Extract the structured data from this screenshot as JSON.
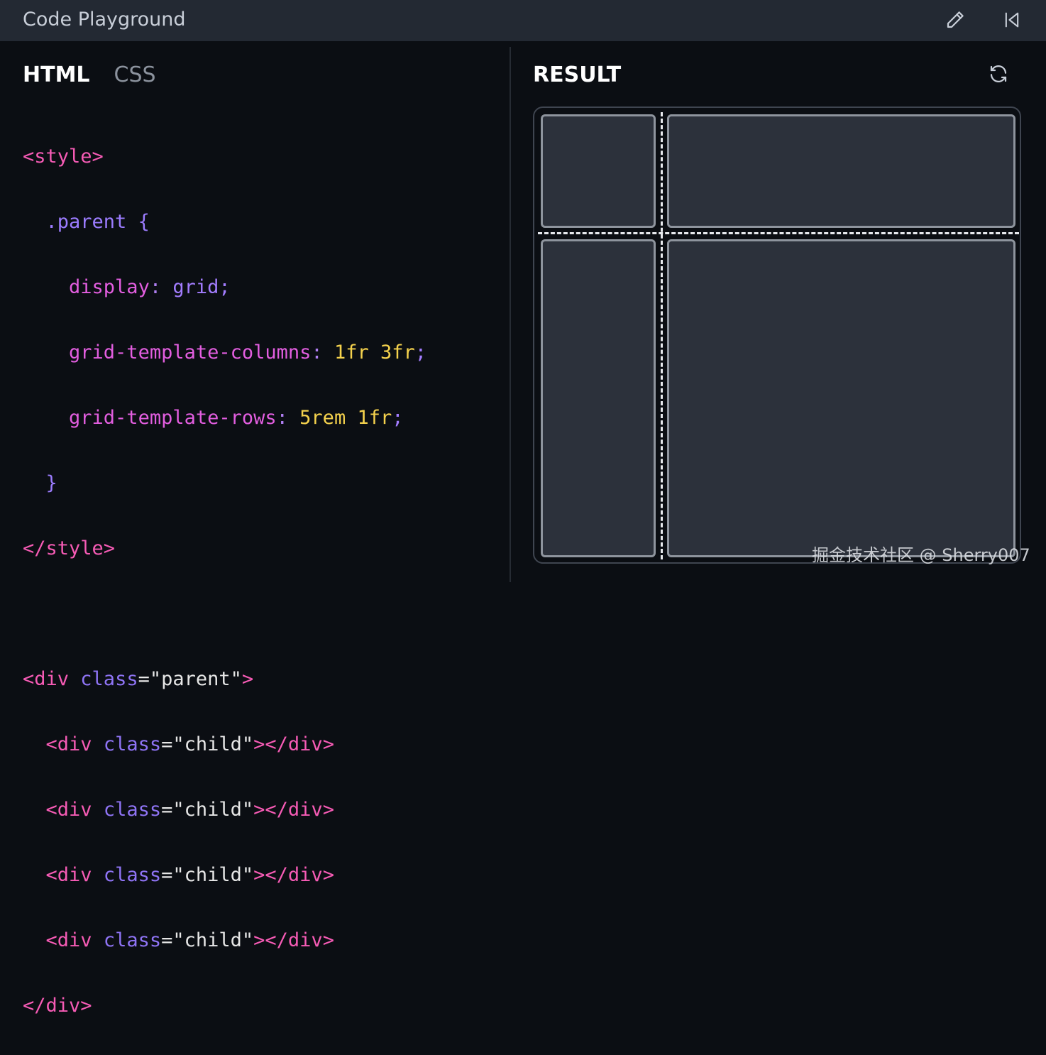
{
  "window": {
    "title": "Code Playground",
    "edit_icon": "pencil-icon",
    "collapse_icon": "collapse-left-icon"
  },
  "editor": {
    "tabs": [
      {
        "label": "HTML",
        "active": true
      },
      {
        "label": "CSS",
        "active": false
      }
    ],
    "code": {
      "l1_tag": "<style>",
      "l2_selector": ".parent",
      "l2_brace": "{",
      "l3_prop": "display",
      "l3_colon": ":",
      "l3_value": "grid;",
      "l4_prop": "grid-template-columns",
      "l4_colon": ":",
      "l4_v1": "1fr",
      "l4_v2": "3fr",
      "l4_semi": ";",
      "l5_prop": "grid-template-rows",
      "l5_colon": ":",
      "l5_v1": "5rem",
      "l5_v2": "1fr",
      "l5_semi": ";",
      "l6_brace": "}",
      "l7_tag": "</style>",
      "l9_open": "<div",
      "l9_attr": "class",
      "l9_eq": "=",
      "l9_str": "\"parent\"",
      "l9_close": ">",
      "child_open": "<div",
      "child_attr": "class",
      "child_eq": "=",
      "child_str": "\"child\"",
      "child_close": "></div>",
      "l14_tag": "</div>"
    }
  },
  "result": {
    "label": "RESULT",
    "refresh_icon": "refresh-icon",
    "grid": {
      "columns": "1fr 3fr",
      "rows": "5rem 1fr",
      "child_count": 4
    }
  },
  "watermark": "掘金技术社区 @ Sherry007",
  "colors": {
    "background": "#0b0e13",
    "titlebar": "#232933",
    "tag": "#f65bb5",
    "property": "#e35ee0",
    "number": "#f5d24d",
    "attribute": "#8f74f5",
    "cell_fill": "#2c313b",
    "cell_border": "#8e949d"
  }
}
